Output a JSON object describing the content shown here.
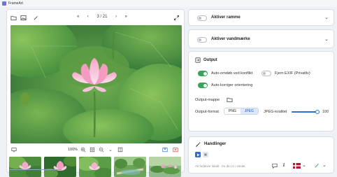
{
  "app": {
    "title": "FrameArt"
  },
  "pager": {
    "prev_first": "«",
    "prev": "‹",
    "position": "3 / 21",
    "next": "›",
    "next_last": "»"
  },
  "zoom": {
    "level": "100%"
  },
  "thumbnails": [
    {
      "name": "lotus-pink-1"
    },
    {
      "name": "lotus-pink-2"
    },
    {
      "name": "lotus-pink-3"
    },
    {
      "name": "lotus-garden"
    },
    {
      "name": "lotus-pond"
    }
  ],
  "frame_card": {
    "label": "Aktiver ramme",
    "enabled": false
  },
  "watermark_card": {
    "label": "Aktiver vandmærke",
    "enabled": false
  },
  "output": {
    "title": "Output",
    "auto_rename_label": "Auto-omdøb ved konflikt",
    "auto_rename": true,
    "strip_exif_label": "Fjern EXIF (Privatliv)",
    "strip_exif": false,
    "auto_orient_label": "Auto-korriger orientering",
    "auto_orient": true,
    "folder_label": "Output-mappe",
    "format_label": "Output-format",
    "format_options": [
      "PNG",
      "JPEG"
    ],
    "format_selected": "JPEG",
    "quality_label": "JPEG-kvalitet",
    "quality_value": "100"
  },
  "actions": {
    "title": "Handlinger",
    "note": "Alt forbliver lokalt - for din ro i sindet."
  },
  "colors": {
    "accent": "#2f6fd6",
    "toggle_on": "#3aa35a",
    "danger": "#e0413a"
  }
}
